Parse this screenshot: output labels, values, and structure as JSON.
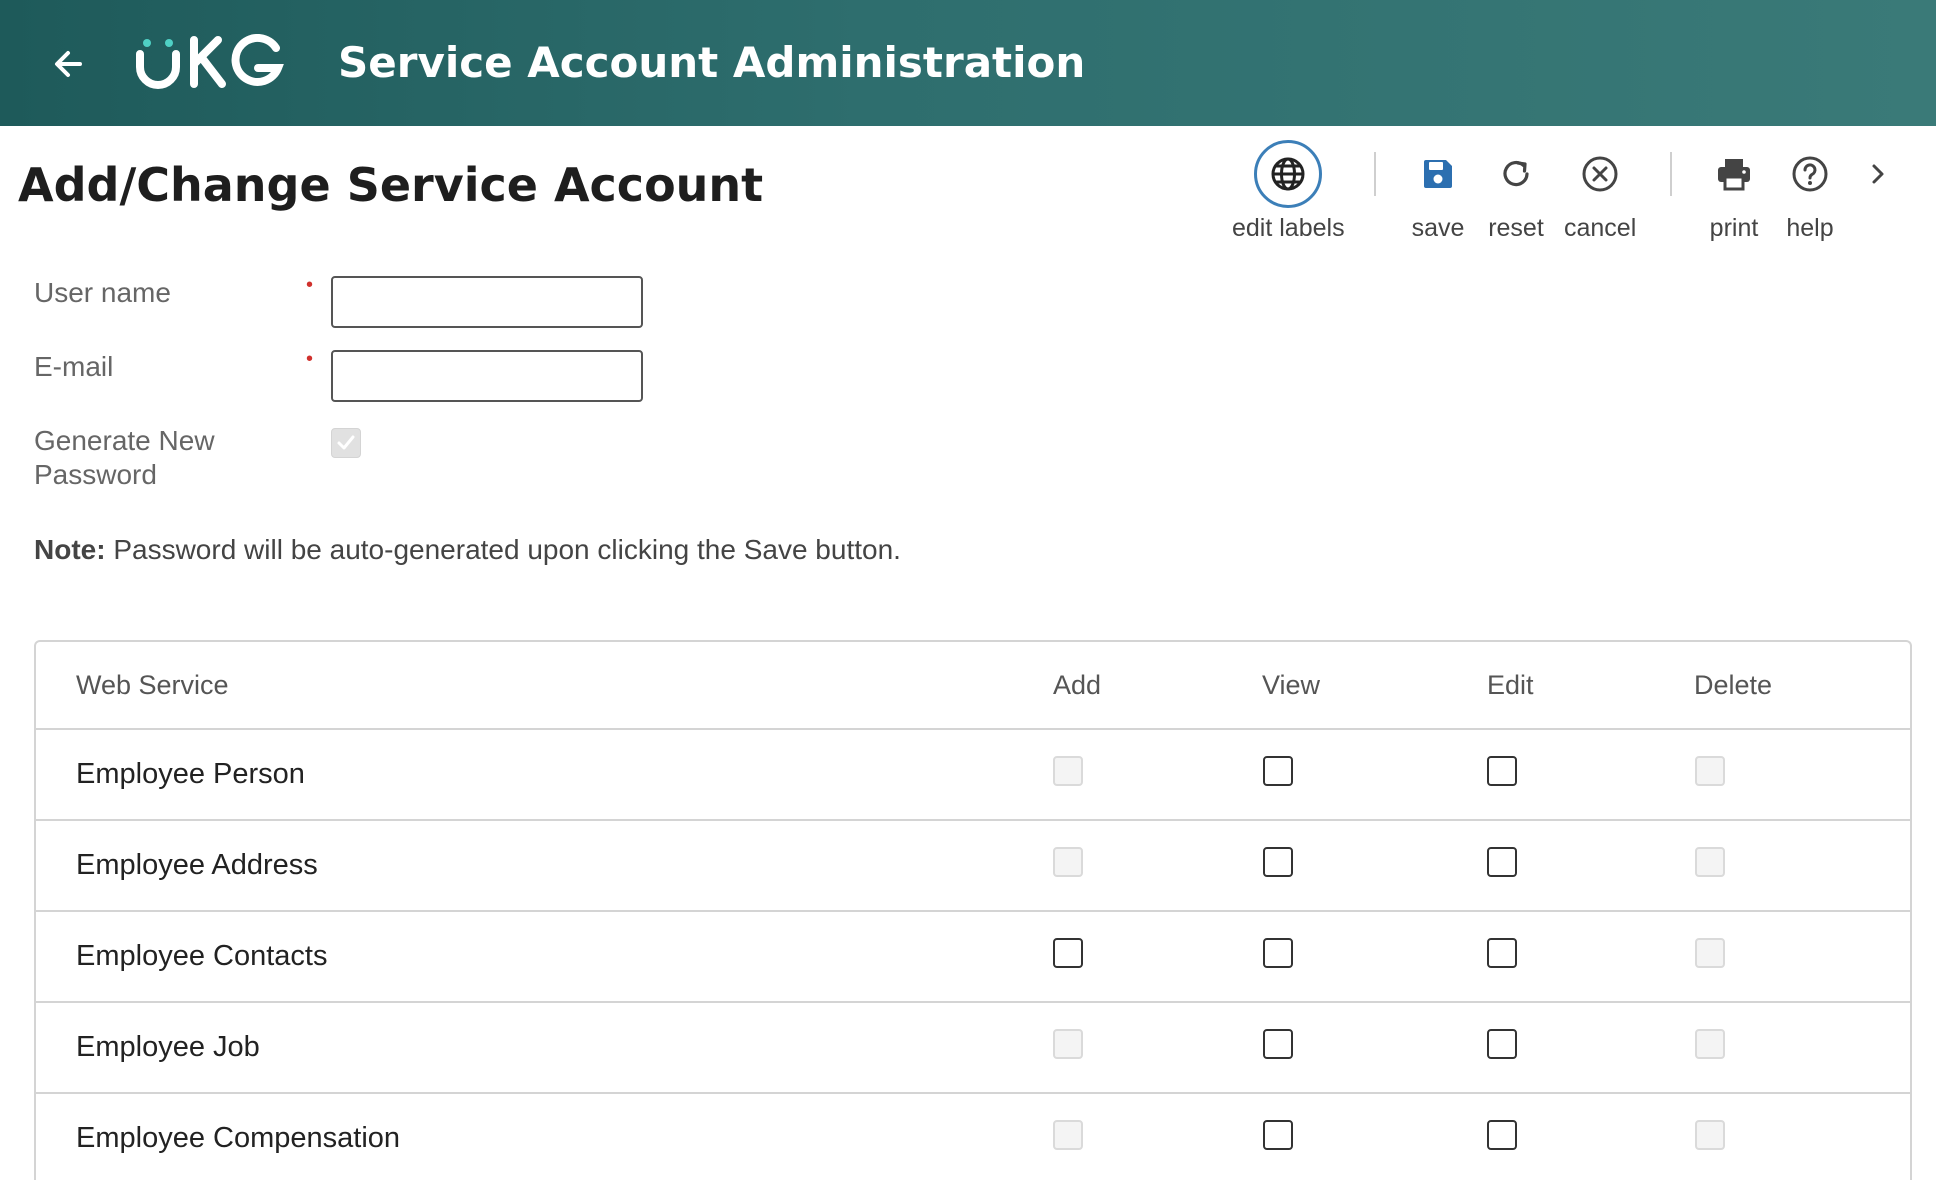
{
  "header": {
    "app_title": "Service Account Administration",
    "logo_text": "UKG",
    "brand_color": "#2a6868",
    "back_icon": "arrow-left-icon"
  },
  "page": {
    "title": "Add/Change Service Account"
  },
  "toolbar": {
    "edit_labels": "edit labels",
    "save": "save",
    "reset": "reset",
    "cancel": "cancel",
    "print": "print",
    "help": "help",
    "more_icon": "chevron-right-icon",
    "accent_color": "#3c7fb8"
  },
  "form": {
    "username_label": "User name",
    "username_value": "",
    "email_label": "E-mail",
    "email_value": "",
    "generate_password_label_line1": "Generate New",
    "generate_password_label_line2": "Password",
    "generate_password_checked": true,
    "required_marker": "•",
    "note_bold": "Note:",
    "note_text": " Password will be auto-generated upon clicking the Save button."
  },
  "grid": {
    "headers": [
      "Web Service",
      "Add",
      "View",
      "Edit",
      "Delete"
    ],
    "rows": [
      {
        "service": "Employee Person",
        "add": "disabled",
        "view": "enabled",
        "edit": "enabled",
        "delete": "disabled"
      },
      {
        "service": "Employee Address",
        "add": "disabled",
        "view": "enabled",
        "edit": "enabled",
        "delete": "disabled"
      },
      {
        "service": "Employee Contacts",
        "add": "enabled",
        "view": "enabled",
        "edit": "enabled",
        "delete": "disabled"
      },
      {
        "service": "Employee Job",
        "add": "disabled",
        "view": "enabled",
        "edit": "enabled",
        "delete": "disabled"
      },
      {
        "service": "Employee Compensation",
        "add": "disabled",
        "view": "enabled",
        "edit": "enabled",
        "delete": "disabled"
      }
    ]
  }
}
